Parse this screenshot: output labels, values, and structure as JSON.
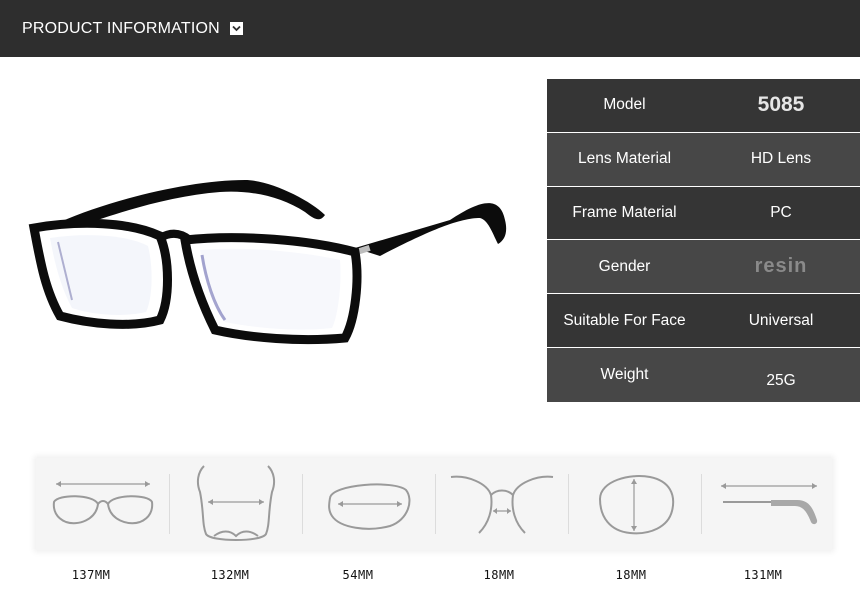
{
  "header": {
    "title": "PRODUCT INFORMATION",
    "chevron_icon": "chevron-down-icon"
  },
  "specs": [
    {
      "label": "Model",
      "value": "5085"
    },
    {
      "label": "Lens Material",
      "value": "HD Lens"
    },
    {
      "label": "Frame Material",
      "value": "PC"
    },
    {
      "label": "Gender",
      "value": "resin"
    },
    {
      "label": "Suitable For Face",
      "value": "Universal"
    },
    {
      "label": "Weight",
      "value": "25G"
    }
  ],
  "measurements": [
    {
      "icon": "frame-width-icon",
      "value": "137MM"
    },
    {
      "icon": "temple-width-icon",
      "value": "132MM"
    },
    {
      "icon": "lens-width-icon",
      "value": "54MM"
    },
    {
      "icon": "bridge-width-icon",
      "value": "18MM"
    },
    {
      "icon": "lens-height-icon",
      "value": "18MM"
    },
    {
      "icon": "temple-length-icon",
      "value": "131MM"
    }
  ],
  "colors": {
    "header_bg": "#2e2e2e",
    "table_dark": "#353535",
    "table_mid": "#474747",
    "icon_stroke": "#9a9a9a"
  }
}
